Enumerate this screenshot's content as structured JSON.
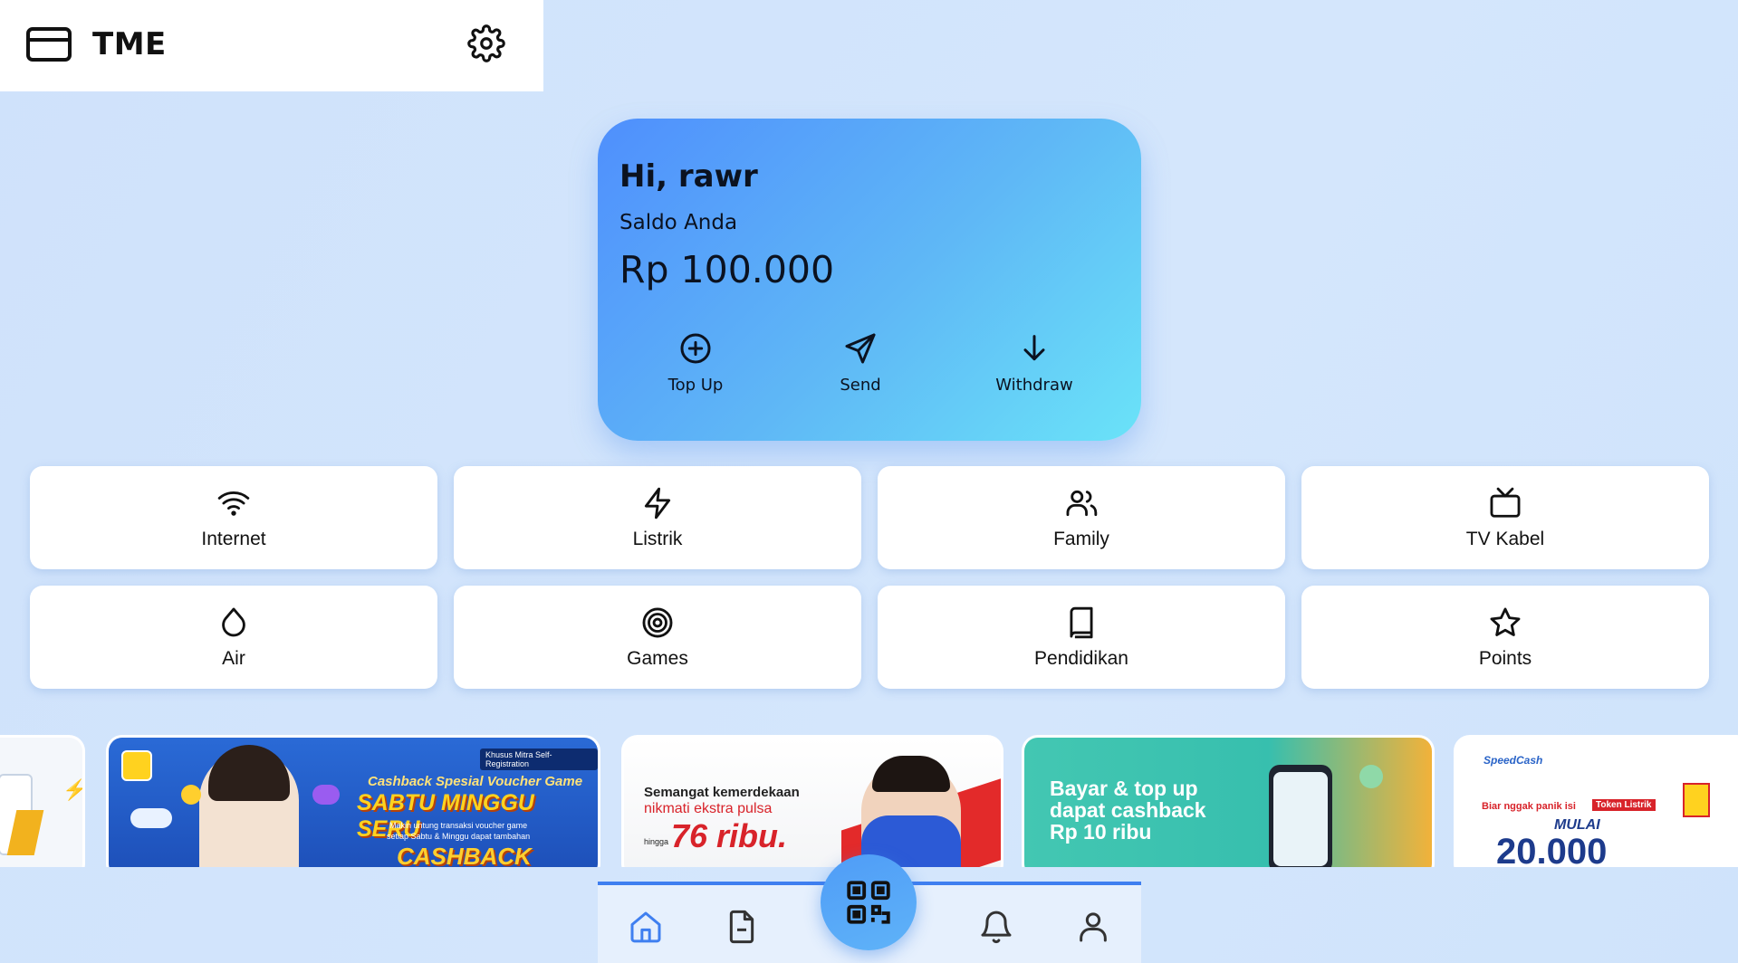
{
  "app": {
    "title": "TME"
  },
  "header": {
    "logo_icon": "card-icon",
    "settings_icon": "gear-icon"
  },
  "balance": {
    "greeting": "Hi, rawr",
    "label": "Saldo Anda",
    "amount": "Rp 100.000",
    "actions": [
      {
        "label": "Top Up",
        "icon": "plus-circle-icon"
      },
      {
        "label": "Send",
        "icon": "send-icon"
      },
      {
        "label": "Withdraw",
        "icon": "arrow-down-icon"
      }
    ]
  },
  "categories": [
    {
      "label": "Internet",
      "icon": "wifi-icon"
    },
    {
      "label": "Listrik",
      "icon": "lightning-icon"
    },
    {
      "label": "Family",
      "icon": "users-icon"
    },
    {
      "label": "TV Kabel",
      "icon": "tv-icon"
    },
    {
      "label": "Air",
      "icon": "droplet-icon"
    },
    {
      "label": "Games",
      "icon": "target-icon"
    },
    {
      "label": "Pendidikan",
      "icon": "book-icon"
    },
    {
      "label": "Points",
      "icon": "star-icon"
    }
  ],
  "promos": [
    {
      "line1": "",
      "line2": "",
      "line3": ""
    },
    {
      "line1": "Khusus Mitra Self-Registration",
      "line2": "Cashback Spesial Voucher Game",
      "line3": "SABTU MINGGU SERU",
      "line4": "Makin untung transaksi voucher game",
      "line5": "setiap Sabtu & Minggu dapat tambahan",
      "line6": "CASHBACK"
    },
    {
      "line1": "Semangat kemerdekaan",
      "line2": "nikmati ekstra pulsa",
      "line3": "hingga",
      "line4": "76 ribu."
    },
    {
      "line1": "Bayar & top up",
      "line2": "dapat cashback",
      "line3": "Rp 10 ribu"
    },
    {
      "line1": "SpeedCash",
      "line2": "Biar nggak panik isi",
      "line3": "Token Listrik",
      "line4": "MULAI",
      "line5": "20.000"
    }
  ],
  "nav": {
    "items": [
      "home-icon",
      "document-icon",
      "qr-code-icon",
      "bell-icon",
      "user-icon"
    ],
    "active": "home-icon"
  },
  "colors": {
    "accent": "#3f7ff0",
    "card_start": "#4f8ffd",
    "card_end": "#6ae3f8",
    "background": "#cfe2fb"
  }
}
